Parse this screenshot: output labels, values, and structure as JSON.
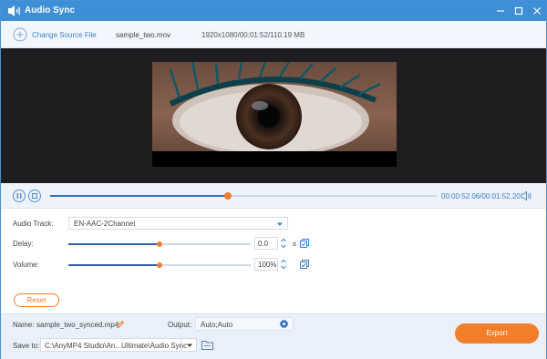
{
  "window": {
    "title": "Audio Sync",
    "accent_color": "#3d8fd6",
    "icons": [
      "audio-sync-app-icon",
      "minimize-icon",
      "maximize-icon",
      "close-icon"
    ]
  },
  "file_bar": {
    "change_label": "Change Source File",
    "file_name": "sample_two.mov",
    "file_info": "1920x1080/00:01:52/110.19 MB"
  },
  "player": {
    "timecode": "00:00:52.06/00:01:52.20",
    "progress": 0.46,
    "icons": [
      "pause-icon",
      "stop-icon",
      "volume-icon"
    ]
  },
  "settings": {
    "audio_track_label": "Audio Track:",
    "audio_track_value": "EN-AAC-2Channel",
    "delay_label": "Delay:",
    "delay_value": "0.0",
    "delay_unit": "s",
    "delay_level": 0.5,
    "volume_label": "Volume:",
    "volume_value": "100%",
    "volume_level": 0.5,
    "reset_label": "Reset"
  },
  "footer": {
    "name_label": "Name:",
    "name_value": "sample_two_synced.mp4",
    "output_label": "Output:",
    "output_value": "Auto;Auto",
    "save_label": "Save to:",
    "save_path": "C:\\AnyMP4 Studio\\An...Ultimate\\Audio Sync",
    "export_label": "Export",
    "export_color": "#f07e2a"
  }
}
